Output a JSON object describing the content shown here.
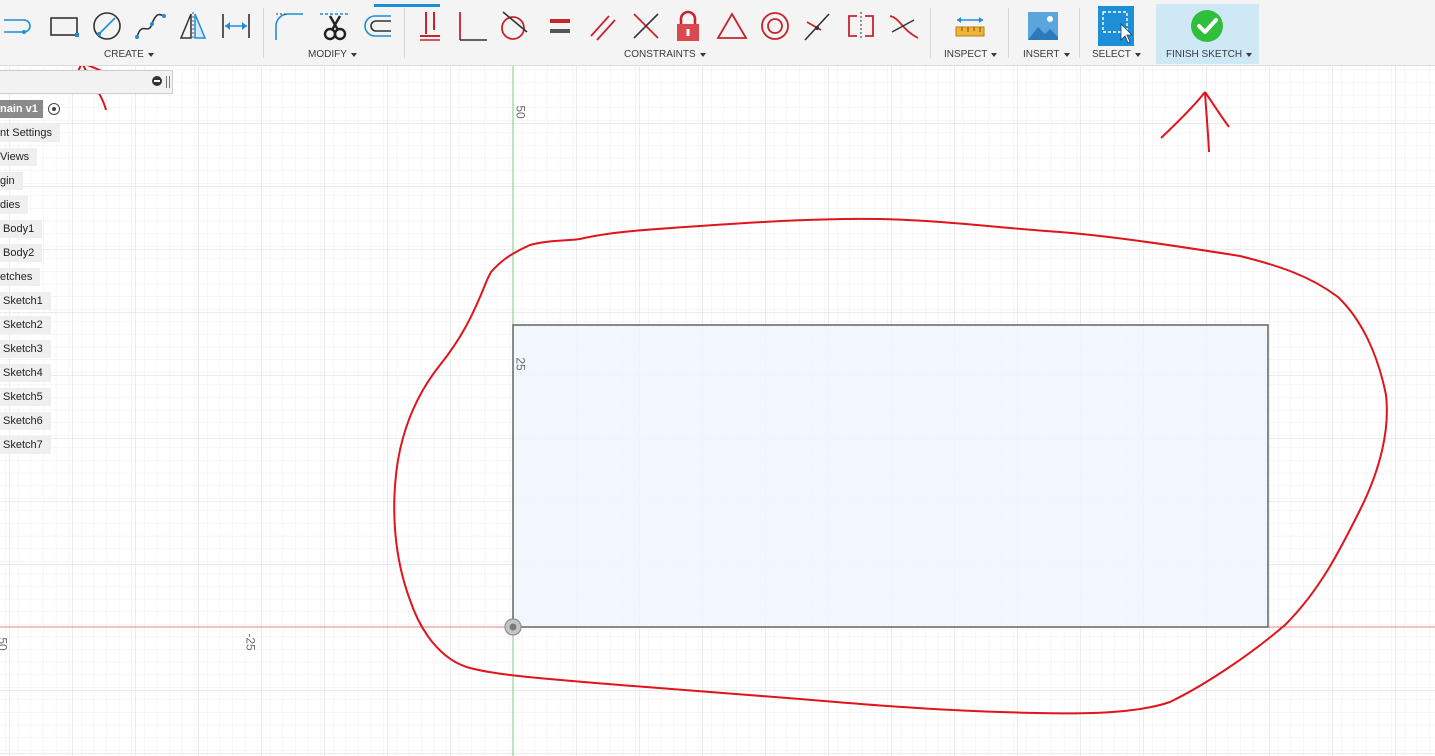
{
  "toolbar": {
    "groups": {
      "create": "CREATE",
      "modify": "MODIFY",
      "constraints": "CONSTRAINTS",
      "inspect": "INSPECT",
      "insert": "INSERT",
      "select": "SELECT",
      "finish": "FINISH SKETCH"
    },
    "icons": {
      "create": [
        "slot-icon",
        "rectangle-icon",
        "circle-icon",
        "spline-icon",
        "mirror-icon",
        "dimension-icon"
      ],
      "modify": [
        "fillet-icon",
        "trim-icon",
        "offset-icon"
      ],
      "constraints": [
        "horizontal-vertical-icon",
        "coincident-icon",
        "tangent-icon",
        "equal-icon",
        "parallel-icon",
        "perpendicular-icon",
        "fix-lock-icon",
        "midpoint-icon",
        "concentric-icon",
        "collinear-icon",
        "symmetry-icon",
        "curvature-icon"
      ],
      "inspect": [
        "measure-icon"
      ],
      "insert": [
        "insert-image-icon"
      ],
      "select": [
        "select-window-icon"
      ],
      "finish": [
        "finish-sketch-check-icon"
      ]
    },
    "colors": {
      "accent_blue": "#1d8fd6",
      "constraint_red": "#c8242b",
      "finish_green": "#2fbf3b",
      "finish_bg": "#cfe8f6"
    }
  },
  "browser": {
    "items": [
      {
        "label": "nain v1",
        "kind": "root"
      },
      {
        "label": "nt Settings"
      },
      {
        "label": "Views"
      },
      {
        "label": "gin"
      },
      {
        "label": "dies"
      },
      {
        "label": "Body1"
      },
      {
        "label": "Body2"
      },
      {
        "label": "etches"
      },
      {
        "label": "Sketch1"
      },
      {
        "label": "Sketch2"
      },
      {
        "label": "Sketch3"
      },
      {
        "label": "Sketch4"
      },
      {
        "label": "Sketch5"
      },
      {
        "label": "Sketch6"
      },
      {
        "label": "Sketch7"
      }
    ]
  },
  "canvas": {
    "axis_labels": {
      "y_top": "50",
      "y_mid": "25",
      "x_left_edge": "50",
      "x_mid": "-25"
    },
    "colors": {
      "grid_minor": "#ececec",
      "grid_major": "#dadada",
      "x_axis": "#e45b5b",
      "y_axis": "#6cc36c",
      "profile_fill": "#eef6fb",
      "profile_stroke": "#6d6d6d",
      "annotation": "#e0141b"
    }
  }
}
